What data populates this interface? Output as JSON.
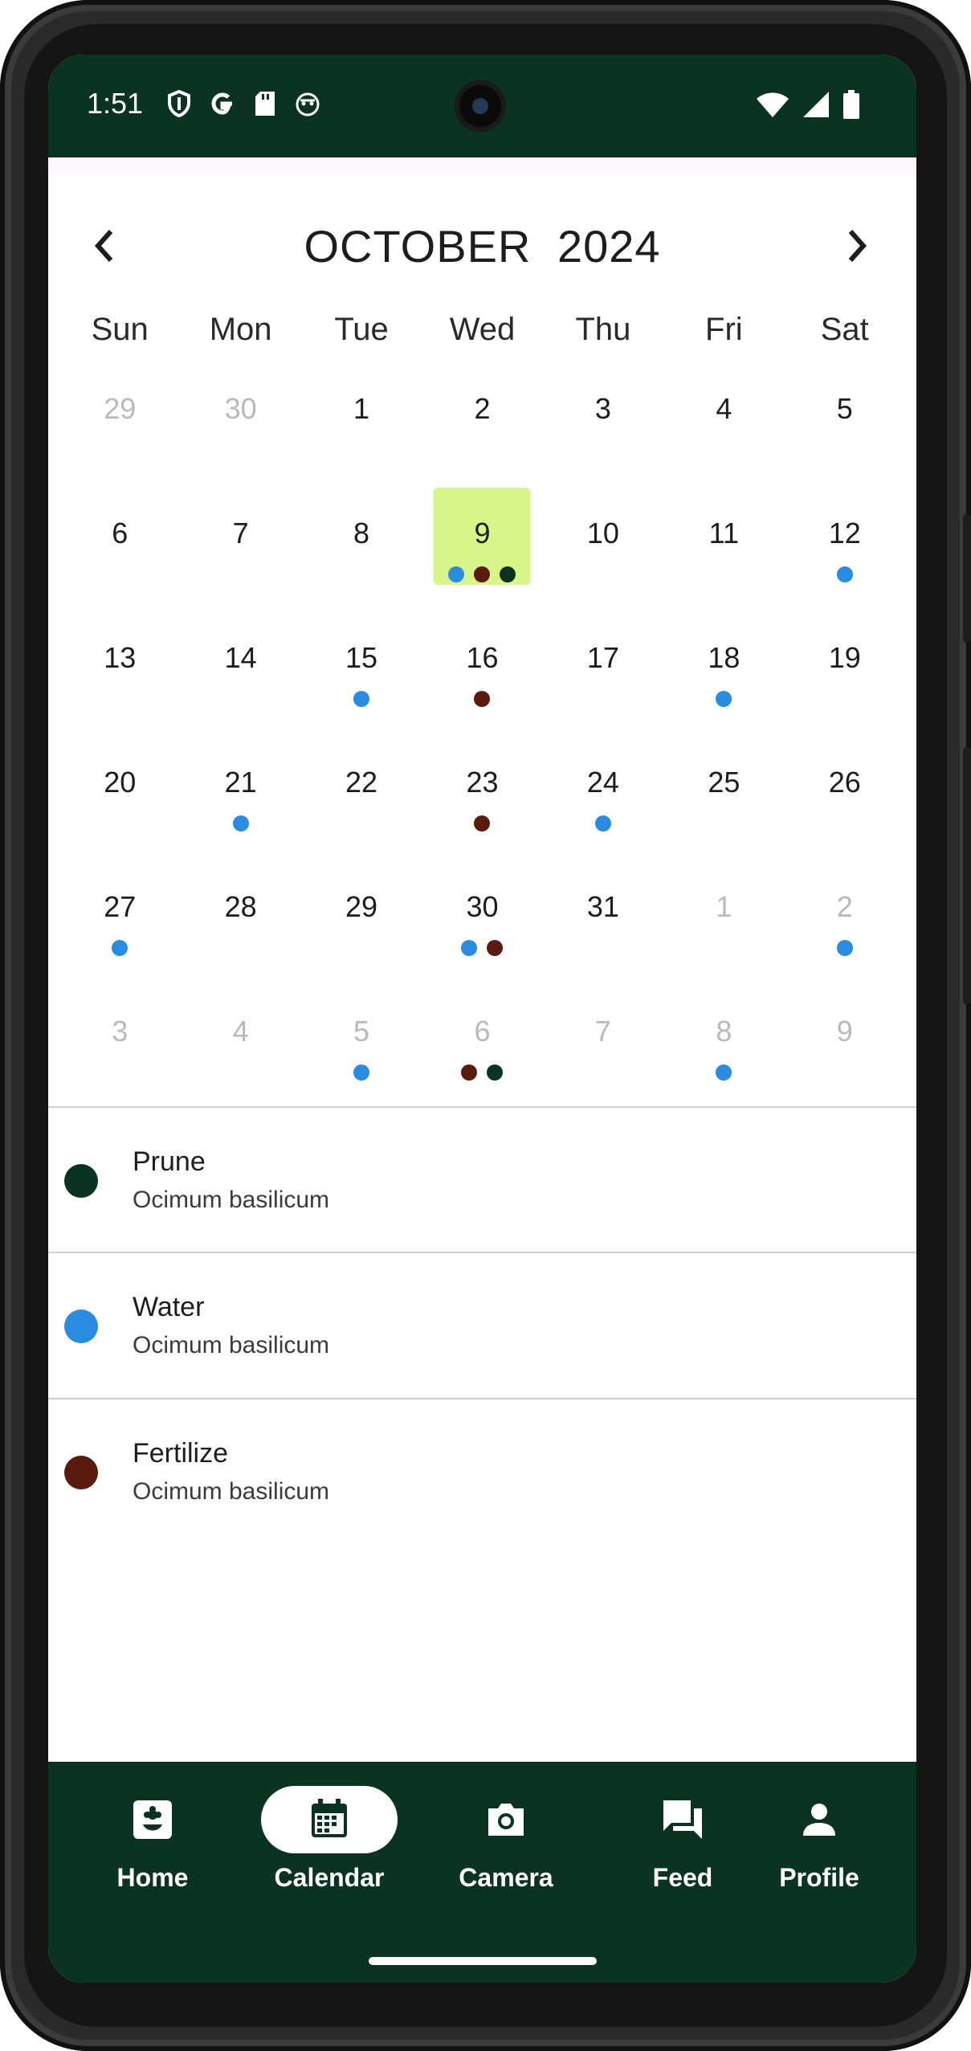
{
  "status_bar": {
    "time": "1:51",
    "left_icons": [
      "shield-icon",
      "google-icon",
      "sd-card-icon",
      "android-icon"
    ],
    "right_icons": [
      "wifi-icon",
      "signal-icon",
      "battery-icon"
    ]
  },
  "calendar": {
    "month": "OCTOBER",
    "year": "2024",
    "weekdays": [
      "Sun",
      "Mon",
      "Tue",
      "Wed",
      "Thu",
      "Fri",
      "Sat"
    ],
    "weeks": [
      [
        {
          "day": "29",
          "muted": true,
          "dots": []
        },
        {
          "day": "30",
          "muted": true,
          "dots": []
        },
        {
          "day": "1",
          "dots": []
        },
        {
          "day": "2",
          "dots": []
        },
        {
          "day": "3",
          "dots": []
        },
        {
          "day": "4",
          "dots": []
        },
        {
          "day": "5",
          "dots": []
        }
      ],
      [
        {
          "day": "6",
          "dots": []
        },
        {
          "day": "7",
          "dots": []
        },
        {
          "day": "8",
          "dots": []
        },
        {
          "day": "9",
          "selected": true,
          "dots": [
            "water",
            "fertilize",
            "prune"
          ]
        },
        {
          "day": "10",
          "dots": []
        },
        {
          "day": "11",
          "dots": []
        },
        {
          "day": "12",
          "dots": [
            "water"
          ]
        }
      ],
      [
        {
          "day": "13",
          "dots": []
        },
        {
          "day": "14",
          "dots": []
        },
        {
          "day": "15",
          "dots": [
            "water"
          ]
        },
        {
          "day": "16",
          "dots": [
            "fertilize"
          ]
        },
        {
          "day": "17",
          "dots": []
        },
        {
          "day": "18",
          "dots": [
            "water"
          ]
        },
        {
          "day": "19",
          "dots": []
        }
      ],
      [
        {
          "day": "20",
          "dots": []
        },
        {
          "day": "21",
          "dots": [
            "water"
          ]
        },
        {
          "day": "22",
          "dots": []
        },
        {
          "day": "23",
          "dots": [
            "fertilize"
          ]
        },
        {
          "day": "24",
          "dots": [
            "water"
          ]
        },
        {
          "day": "25",
          "dots": []
        },
        {
          "day": "26",
          "dots": []
        }
      ],
      [
        {
          "day": "27",
          "dots": [
            "water"
          ]
        },
        {
          "day": "28",
          "dots": []
        },
        {
          "day": "29",
          "dots": []
        },
        {
          "day": "30",
          "dots": [
            "water",
            "fertilize"
          ]
        },
        {
          "day": "31",
          "dots": []
        },
        {
          "day": "1",
          "muted": true,
          "dots": []
        },
        {
          "day": "2",
          "muted": true,
          "dots": [
            "water"
          ]
        }
      ],
      [
        {
          "day": "3",
          "muted": true,
          "dots": []
        },
        {
          "day": "4",
          "muted": true,
          "dots": []
        },
        {
          "day": "5",
          "muted": true,
          "dots": [
            "water"
          ]
        },
        {
          "day": "6",
          "muted": true,
          "dots": [
            "fertilize",
            "prune"
          ]
        },
        {
          "day": "7",
          "muted": true,
          "dots": []
        },
        {
          "day": "8",
          "muted": true,
          "dots": [
            "water"
          ]
        },
        {
          "day": "9",
          "muted": true,
          "dots": []
        }
      ]
    ]
  },
  "event_colors": {
    "water": "#2a8ce0",
    "fertilize": "#5a1a0e",
    "prune": "#0b3321"
  },
  "legend": [
    {
      "key": "prune",
      "title": "Prune",
      "subtitle": "Ocimum basilicum"
    },
    {
      "key": "water",
      "title": "Water",
      "subtitle": "Ocimum basilicum"
    },
    {
      "key": "fertilize",
      "title": "Fertilize",
      "subtitle": "Ocimum basilicum"
    }
  ],
  "bottom_nav": {
    "active": "Calendar",
    "items": [
      {
        "label": "Home",
        "icon": "plant-icon"
      },
      {
        "label": "Calendar",
        "icon": "calendar-icon"
      },
      {
        "label": "Camera",
        "icon": "camera-icon"
      },
      {
        "label": "Feed",
        "icon": "chat-icon"
      },
      {
        "label": "Profile",
        "icon": "person-icon"
      }
    ]
  },
  "colors": {
    "primary_dark": "#0b3321",
    "selected_day_bg": "#d8f58a"
  }
}
